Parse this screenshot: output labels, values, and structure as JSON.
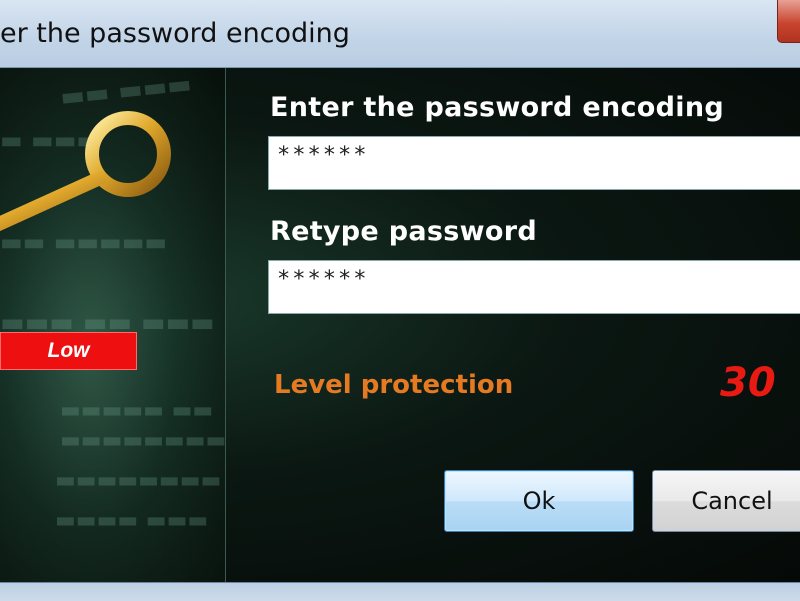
{
  "window": {
    "title": "er the password encoding"
  },
  "form": {
    "password_label": "Enter the password encoding",
    "password_value": "******",
    "retype_label": "Retype password",
    "retype_value": "******"
  },
  "strength": {
    "badge_text": "Low",
    "badge_color": "#ee1010",
    "level_label": "Level protection",
    "level_value": "30",
    "level_label_color": "#e57a22",
    "level_value_color": "#e81a12"
  },
  "buttons": {
    "ok_label": "Ok",
    "cancel_label": "Cancel"
  },
  "icons": {
    "window_close": "close-icon",
    "decoration": "key-icon"
  }
}
